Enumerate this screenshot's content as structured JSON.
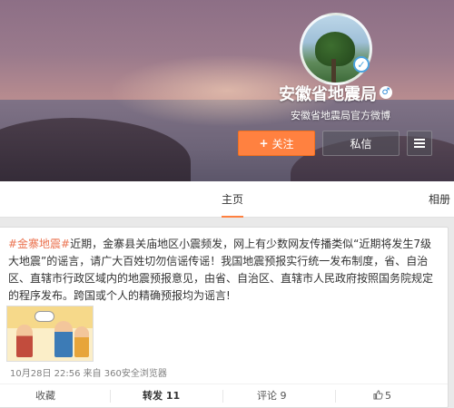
{
  "profile": {
    "name": "安徽省地震局",
    "description": "安徽省地震局官方微博",
    "follow_label": "关注",
    "message_label": "私信"
  },
  "tabs": {
    "home": "主页",
    "album": "相册"
  },
  "post": {
    "topic": "#金寨地震#",
    "text": "近期，金寨县关庙地区小震频发，网上有少数网友传播类似“近期将发生7级大地震”的谣言，请广大百姓切勿信谣传谣！我国地震预报实行统一发布制度，省、自治区、直辖市行政区域内的地震预报意见，由省、自治区、直辖市人民政府按照国务院规定的程序发布。跨国或个人的精确预报均为谣言!",
    "time": "10月28日 22:56",
    "source": " 来自 360安全浏览器",
    "actions": {
      "favorite": "收藏",
      "repost": "转发 11",
      "comment": "评论 9",
      "like": "5"
    }
  },
  "colors": {
    "accent": "#ff8140",
    "topic": "#eb7350"
  }
}
